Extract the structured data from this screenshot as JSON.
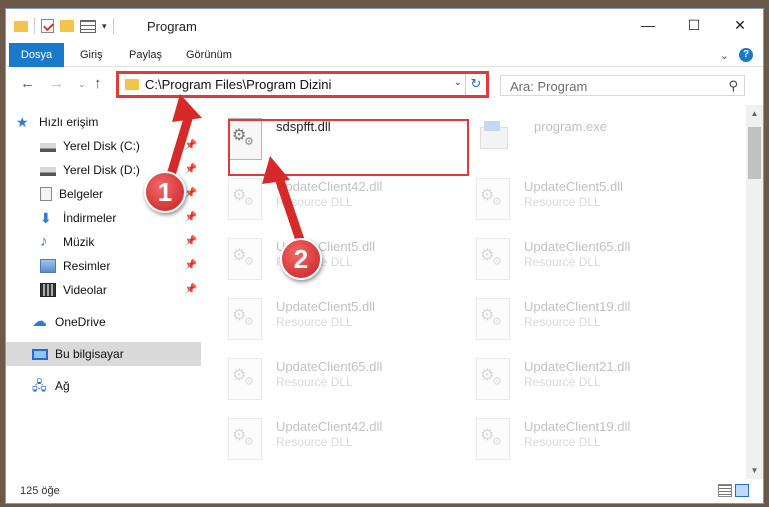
{
  "window": {
    "title": "Program",
    "controls": {
      "minimize": "—",
      "maximize": "☐",
      "close": "✕"
    }
  },
  "ribbon": {
    "tabs": [
      "Dosya",
      "Giriş",
      "Paylaş",
      "Görünüm"
    ],
    "expand_icon": "chevron-down-icon",
    "help": "?"
  },
  "nav": {
    "address_path": "C:\\Program Files\\Program Dizini",
    "search_placeholder": "Ara: Program"
  },
  "sidebar": {
    "items": [
      {
        "label": "Hızlı erişim",
        "icon": "star-icon",
        "pinned": false
      },
      {
        "label": "Yerel Disk (C:)",
        "icon": "drive-icon",
        "pinned": true
      },
      {
        "label": "Yerel Disk (D:)",
        "icon": "drive-icon",
        "pinned": true
      },
      {
        "label": "Belgeler",
        "icon": "documents-icon",
        "pinned": true
      },
      {
        "label": "İndirmeler",
        "icon": "downloads-icon",
        "pinned": true
      },
      {
        "label": "Müzik",
        "icon": "music-icon",
        "pinned": true
      },
      {
        "label": "Resimler",
        "icon": "pictures-icon",
        "pinned": true
      },
      {
        "label": "Videolar",
        "icon": "videos-icon",
        "pinned": true
      },
      {
        "label": "OneDrive",
        "icon": "onedrive-icon",
        "pinned": false
      },
      {
        "label": "Bu bilgisayar",
        "icon": "computer-icon",
        "pinned": false,
        "selected": true
      },
      {
        "label": "Ağ",
        "icon": "network-icon",
        "pinned": false
      }
    ]
  },
  "files": [
    {
      "name": "sdspfft.dll",
      "type": "",
      "highlighted": true
    },
    {
      "name": "program.exe",
      "type": "",
      "faded": true
    },
    {
      "name": "UpdateClient42.dll",
      "type": "Resource DLL",
      "faded": true
    },
    {
      "name": "UpdateClient5.dll",
      "type": "Resource DLL",
      "faded": true
    },
    {
      "name": "UpdateClient5.dll",
      "type": "Resource DLL",
      "faded": true
    },
    {
      "name": "UpdateClient65.dll",
      "type": "Resource DLL",
      "faded": true
    },
    {
      "name": "UpdateClient5.dll",
      "type": "Resource DLL",
      "faded": true
    },
    {
      "name": "UpdateClient19.dll",
      "type": "Resource DLL",
      "faded": true
    },
    {
      "name": "UpdateClient65.dll",
      "type": "Resource DLL",
      "faded": true
    },
    {
      "name": "UpdateClient21.dll",
      "type": "Resource DLL",
      "faded": true
    },
    {
      "name": "UpdateClient42.dll",
      "type": "Resource DLL",
      "faded": true
    },
    {
      "name": "UpdateClient19.dll",
      "type": "Resource DLL",
      "faded": true
    }
  ],
  "status": {
    "item_count": "125 öğe"
  },
  "callouts": [
    "1",
    "2"
  ],
  "colors": {
    "accent": "#1979ca",
    "callout_red": "#d62a2a",
    "highlight_border": "#e03a3a"
  }
}
